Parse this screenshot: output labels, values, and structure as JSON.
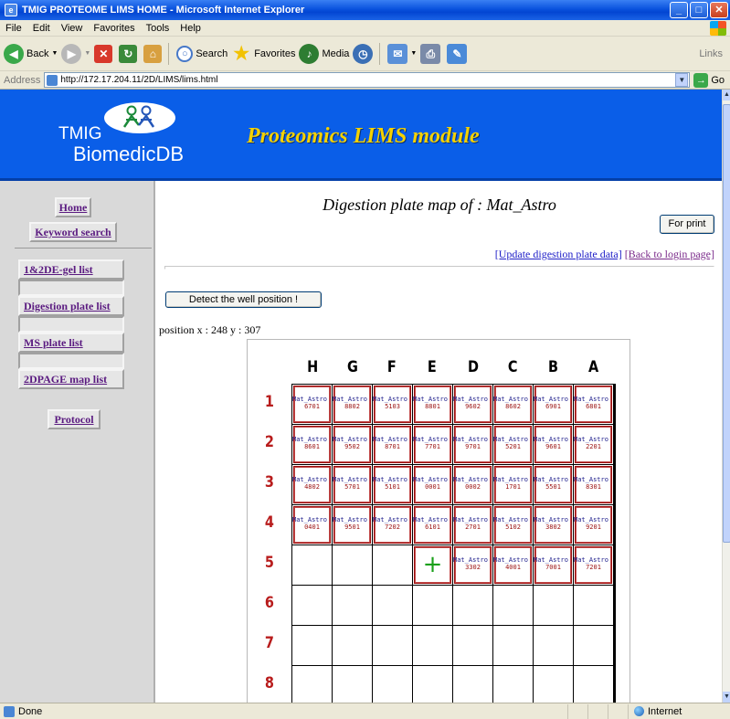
{
  "window": {
    "title": "TMIG PROTEOME LIMS HOME - Microsoft Internet Explorer"
  },
  "menu": [
    "File",
    "Edit",
    "View",
    "Favorites",
    "Tools",
    "Help"
  ],
  "toolbar": {
    "back": "Back",
    "search": "Search",
    "favorites": "Favorites",
    "media": "Media",
    "links": "Links"
  },
  "address": {
    "label": "Address",
    "url": "http://172.17.204.11/2D/LIMS/lims.html",
    "go": "Go"
  },
  "banner": {
    "logo_line1": "TMIG",
    "logo_line2": "BiomedicDB",
    "title": "Proteomics LIMS module"
  },
  "nav": {
    "home": "Home",
    "keyword_search": "Keyword search",
    "gel_list": "1&2DE-gel list",
    "digestion_plate_list": "Digestion plate list",
    "ms_plate_list": "MS plate list",
    "map_list": "2DPAGE map list",
    "protocol": "Protocol"
  },
  "main": {
    "heading": "Digestion plate map of : Mat_Astro",
    "print_button": "For print",
    "update_link": "[Update digestion plate data]",
    "back_link": "[Back to login page]",
    "detect_button": "Detect the well position !",
    "position_text": "position x : 248 y : 307"
  },
  "plate": {
    "columns": [
      "H",
      "G",
      "F",
      "E",
      "D",
      "C",
      "B",
      "A"
    ],
    "rows": [
      "1",
      "2",
      "3",
      "4",
      "5",
      "6",
      "7",
      "8"
    ],
    "sample_label": "Mat_Astro",
    "marker_symbol": "+",
    "wells": [
      [
        "6701",
        "8802",
        "5103",
        "8801",
        "9602",
        "8602",
        "6901",
        "6801"
      ],
      [
        "8601",
        "9502",
        "8701",
        "7701",
        "9701",
        "5201",
        "9601",
        "2201"
      ],
      [
        "4802",
        "5701",
        "5101",
        "0001",
        "0002",
        "1701",
        "5501",
        "8301"
      ],
      [
        "0401",
        "9501",
        "7202",
        "6101",
        "2701",
        "5102",
        "3802",
        "9201"
      ],
      [
        "",
        "",
        "",
        "+",
        "3302",
        "4001",
        "7001",
        "7201"
      ],
      [
        "",
        "",
        "",
        "",
        "",
        "",
        "",
        ""
      ],
      [
        "",
        "",
        "",
        "",
        "",
        "",
        "",
        ""
      ],
      [
        "",
        "",
        "",
        "",
        "",
        "",
        "",
        ""
      ]
    ]
  },
  "status": {
    "left": "Done",
    "zone": "Internet"
  }
}
